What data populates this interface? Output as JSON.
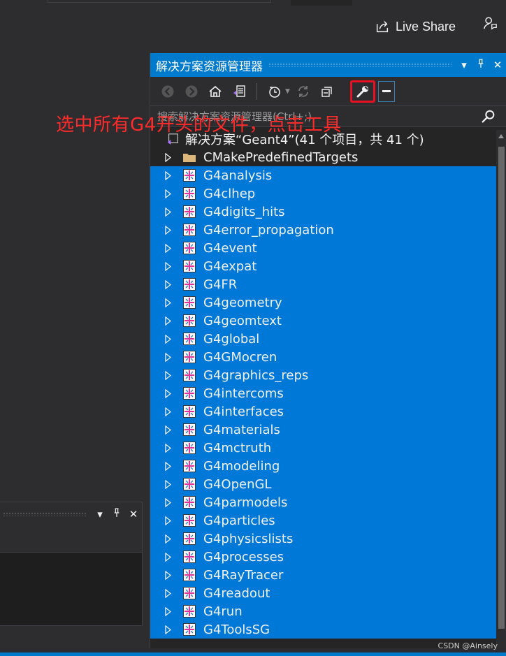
{
  "app": {
    "live_share_label": "Live Share",
    "accent": "#007acc"
  },
  "panel": {
    "title": "解决方案资源管理器",
    "controls": {
      "dropdown": "▾",
      "pin": "⊿",
      "close": "✕"
    }
  },
  "toolbar": {
    "icons": [
      "back-icon",
      "forward-icon",
      "home-icon",
      "switch-views-icon",
      "pending-changes-icon",
      "sync-icon",
      "collapse-all-icon",
      "properties-wrench-icon",
      "minimize-icon"
    ]
  },
  "search": {
    "placeholder": "搜索解决方案资源管理器(Ctrl+;)"
  },
  "annotation": {
    "text": "选中所有G4开头的文件，点击工具",
    "color": "#ff2a2a"
  },
  "tree": {
    "solution_label": "解决方案“Geant4”(41 个项目，共 41 个)",
    "folder": "CMakePredefinedTargets",
    "projects": [
      "G4analysis",
      "G4clhep",
      "G4digits_hits",
      "G4error_propagation",
      "G4event",
      "G4expat",
      "G4FR",
      "G4geometry",
      "G4geomtext",
      "G4global",
      "G4GMocren",
      "G4graphics_reps",
      "G4intercoms",
      "G4interfaces",
      "G4materials",
      "G4mctruth",
      "G4modeling",
      "G4OpenGL",
      "G4parmodels",
      "G4particles",
      "G4physicslists",
      "G4processes",
      "G4RayTracer",
      "G4readout",
      "G4run",
      "G4ToolsSG"
    ],
    "selection_color": "#0078d7"
  },
  "watermark": "CSDN @Ainsely"
}
